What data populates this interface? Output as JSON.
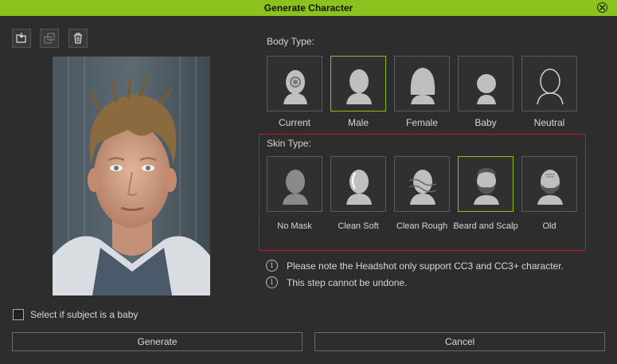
{
  "window": {
    "title": "Generate Character"
  },
  "toolbar": {
    "icons": [
      "load-photo-icon",
      "copy-icon",
      "trash-icon"
    ]
  },
  "body_type": {
    "label": "Body Type:",
    "selected": "Male",
    "options": [
      "Current",
      "Male",
      "Female",
      "Baby",
      "Neutral"
    ]
  },
  "skin_type": {
    "label": "Skin Type:",
    "selected": "Beard and Scalp",
    "options": [
      "No Mask",
      "Clean Soft",
      "Clean Rough",
      "Beard and Scalp",
      "Old"
    ]
  },
  "notes": [
    "Please note the Headshot only support CC3 and CC3+ character.",
    "This step cannot be undone."
  ],
  "baby_checkbox": {
    "label": "Select if subject is a baby",
    "checked": false
  },
  "buttons": {
    "generate": "Generate",
    "cancel": "Cancel"
  },
  "colors": {
    "accent": "#8bc21d",
    "skin_frame": "#c8161d",
    "background": "#2d2d2d"
  }
}
